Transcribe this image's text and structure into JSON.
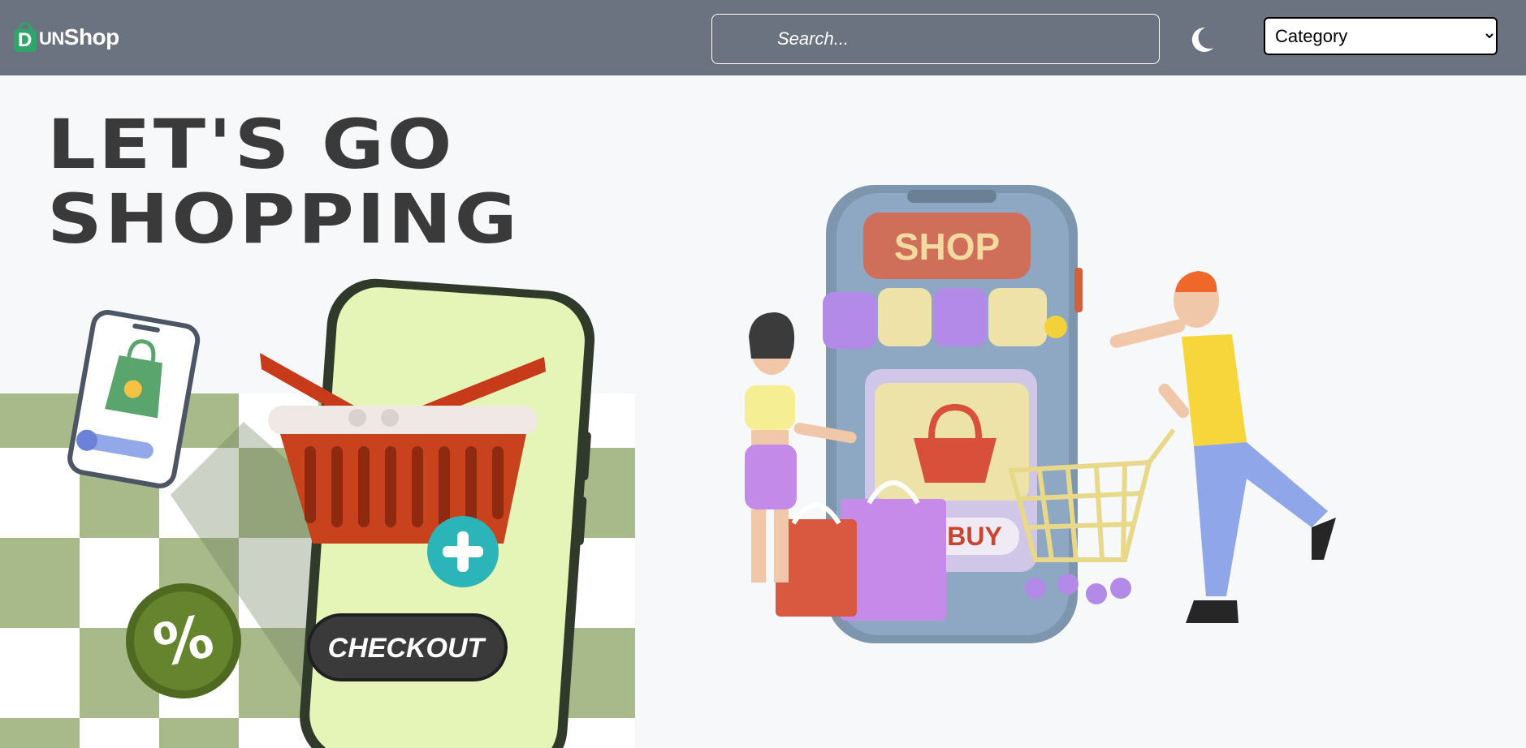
{
  "header": {
    "logo": {
      "letter": "D",
      "text_small": "UN",
      "text_main": "Shop"
    },
    "search": {
      "placeholder": "Search..."
    },
    "theme_toggle_icon": "moon-icon",
    "category_select": {
      "selected": "Category"
    }
  },
  "hero": {
    "title_line1": "LET'S GO",
    "title_line2": "SHOPPING"
  },
  "illustration_left": {
    "checkout_label": "CHECKOUT",
    "percent_symbol": "%"
  },
  "illustration_right": {
    "shop_sign": "SHOP",
    "buy_label": "BUY"
  },
  "colors": {
    "navbar": "#6b7280",
    "background": "#f7f8fa",
    "brand_green": "#2fa56b",
    "checker_green": "#a8b98a",
    "title": "#3a3a3a"
  }
}
